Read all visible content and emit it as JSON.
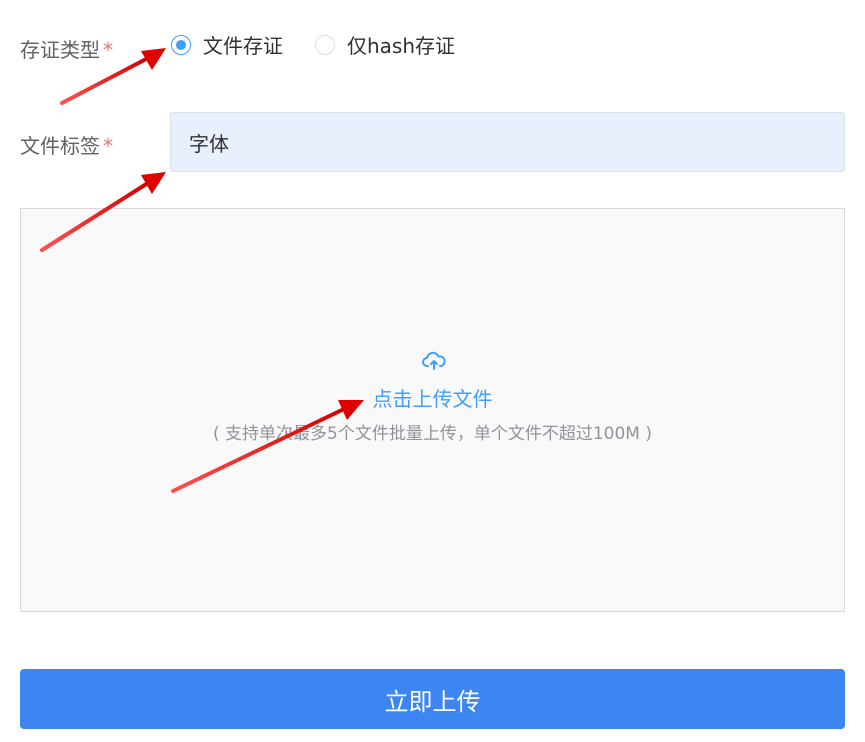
{
  "form": {
    "evidence_type": {
      "label": "存证类型",
      "required_mark": "*",
      "options": [
        {
          "label": "文件存证",
          "checked": true
        },
        {
          "label": "仅hash存证",
          "checked": false
        }
      ]
    },
    "file_tag": {
      "label": "文件标签",
      "required_mark": "*",
      "value": "字体"
    }
  },
  "upload": {
    "icon": "cloud-upload-icon",
    "link_text": "点击上传文件",
    "hint_text": "( 支持单次最多5个文件批量上传，单个文件不超过100M )"
  },
  "submit": {
    "label": "立即上传"
  },
  "colors": {
    "primary": "#409eff",
    "button": "#3d85f0",
    "required": "#f56c6c",
    "input_bg": "#e8f0fe",
    "upload_bg": "#f9f9f9",
    "annotation_arrow": "#e00000"
  }
}
